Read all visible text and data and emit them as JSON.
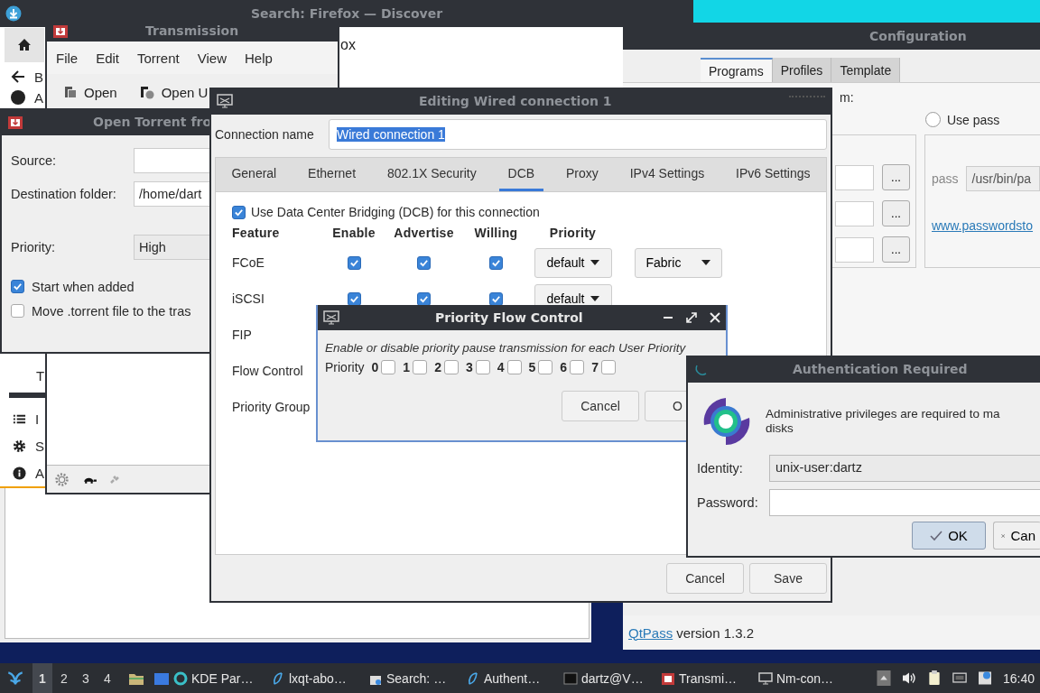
{
  "discover": {
    "title": "Search: Firefox — Discover",
    "header_fragment": "ox",
    "nav": [
      {
        "label": "B"
      },
      {
        "label": "A"
      }
    ],
    "sidebar_heading": "T",
    "sidebar_items": [
      {
        "label": "I"
      },
      {
        "label": "S"
      },
      {
        "label": "A"
      }
    ]
  },
  "configuration": {
    "title": "Configuration",
    "tabs": [
      {
        "label": "Programs",
        "selected": true
      },
      {
        "label": "Profiles",
        "selected": false
      },
      {
        "label": "Template",
        "selected": false
      }
    ],
    "section_fragment": "m:",
    "use_pass": {
      "label": "Use pass",
      "selected": false
    },
    "browse_buttons": [
      "...",
      "...",
      "..."
    ],
    "pass_label": "pass",
    "pass_path": {
      "value": "/usr/bin/pa",
      "disabled": true
    },
    "website_link": "www.passwordsto",
    "footer": {
      "link": "QtPass",
      "text": "version 1.3.2"
    }
  },
  "transmission": {
    "title": "Transmission",
    "menu": [
      "File",
      "Edit",
      "Torrent",
      "View",
      "Help"
    ],
    "toolbar": [
      "Open",
      "Open U"
    ]
  },
  "open_torrent": {
    "title": "Open Torrent fro",
    "fields": [
      {
        "label": "Source:",
        "kind": "text"
      },
      {
        "label": "Destination folder:",
        "value": "/home/dart",
        "kind": "text"
      },
      {
        "label": "Priority:",
        "value": "High",
        "kind": "combo"
      }
    ],
    "options": [
      {
        "label": "Start when added",
        "checked": true
      },
      {
        "label": "Move .torrent file to the tras",
        "checked": false
      }
    ]
  },
  "editing": {
    "title": "Editing Wired connection 1",
    "connection_label": "Connection name",
    "connection_name": "Wired connection 1",
    "tabs": [
      {
        "label": "General",
        "selected": false
      },
      {
        "label": "Ethernet",
        "selected": false
      },
      {
        "label": "802.1X Security",
        "selected": false
      },
      {
        "label": "DCB",
        "selected": true
      },
      {
        "label": "Proxy",
        "selected": false
      },
      {
        "label": "IPv4 Settings",
        "selected": false
      },
      {
        "label": "IPv6 Settings",
        "selected": false
      }
    ],
    "use_dcb": {
      "label": "Use Data Center Bridging (DCB) for this connection",
      "checked": true
    },
    "columns": [
      "Feature",
      "Enable",
      "Advertise",
      "Willing",
      "Priority"
    ],
    "rows": [
      {
        "feature": "FCoE",
        "enable": true,
        "advertise": true,
        "willing": true,
        "priority": "default",
        "mode": "Fabric"
      },
      {
        "feature": "iSCSI",
        "enable": true,
        "advertise": true,
        "willing": true,
        "priority": "default"
      },
      {
        "feature": "FIP"
      },
      {
        "feature": "Flow Control"
      },
      {
        "feature": "Priority Group"
      }
    ],
    "buttons": [
      "Cancel",
      "Save"
    ]
  },
  "pfc": {
    "title": "Priority Flow Control",
    "description": "Enable or disable priority pause transmission for each User Priority",
    "priority_label": "Priority",
    "priorities": [
      {
        "label": "0",
        "checked": false
      },
      {
        "label": "1",
        "checked": false
      },
      {
        "label": "2",
        "checked": false
      },
      {
        "label": "3",
        "checked": false
      },
      {
        "label": "4",
        "checked": false
      },
      {
        "label": "5",
        "checked": false
      },
      {
        "label": "6",
        "checked": false
      },
      {
        "label": "7",
        "checked": false
      }
    ],
    "buttons": [
      "Cancel",
      "O"
    ]
  },
  "auth": {
    "title": "Authentication Required",
    "message_line_1": "Administrative privileges are required to ma",
    "message_line_2": "disks",
    "identity_label": "Identity:",
    "identity": "unix-user:dartz",
    "password_label": "Password:",
    "buttons": [
      {
        "label": "OK",
        "kind": "ok",
        "default": true
      },
      {
        "label": "Can",
        "kind": "cancel",
        "default": false
      }
    ]
  },
  "taskbar": {
    "workspaces": [
      {
        "label": "1",
        "selected": true
      },
      {
        "label": "2",
        "selected": false
      },
      {
        "label": "3",
        "selected": false
      },
      {
        "label": "4",
        "selected": false
      }
    ],
    "tasks": [
      {
        "label": "KDE Par…"
      },
      {
        "label": "lxqt-abo…"
      },
      {
        "label": "Search: …"
      },
      {
        "label": "Authent…"
      },
      {
        "label": "dartz@V…"
      },
      {
        "label": "Transmi…"
      },
      {
        "label": "Nm-con…"
      }
    ],
    "clock": "16:40"
  }
}
